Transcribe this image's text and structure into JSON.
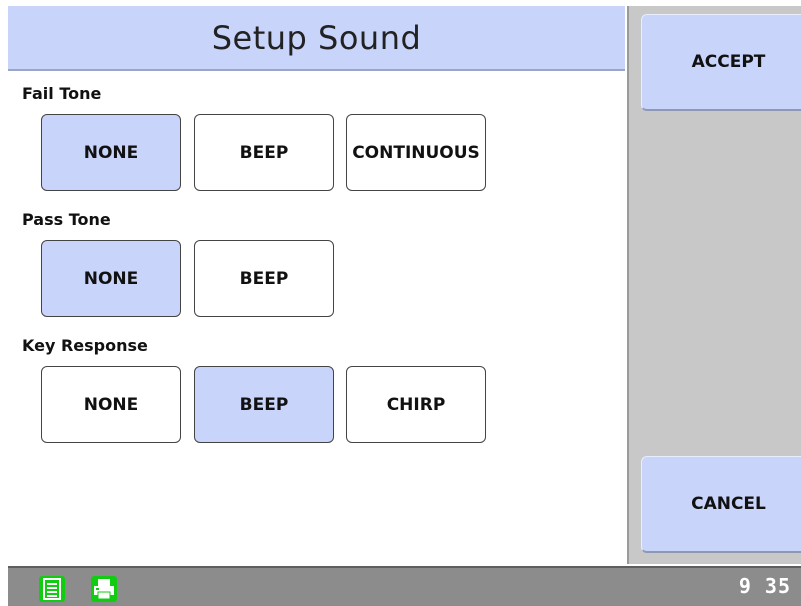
{
  "header": {
    "title": "Setup Sound"
  },
  "groups": [
    {
      "label": "Fail Tone",
      "options": [
        "NONE",
        "BEEP",
        "CONTINUOUS"
      ],
      "selected": "NONE"
    },
    {
      "label": "Pass Tone",
      "options": [
        "NONE",
        "BEEP"
      ],
      "selected": "NONE"
    },
    {
      "label": "Key Response",
      "options": [
        "NONE",
        "BEEP",
        "CHIRP"
      ],
      "selected": "BEEP"
    }
  ],
  "sidebar": {
    "accept_label": "ACCEPT",
    "cancel_label": "CANCEL"
  },
  "status": {
    "time_hours": "9",
    "time_minutes": "35",
    "icons": [
      "list-icon",
      "printer-icon"
    ]
  },
  "colors": {
    "selected": "#c9d4fb",
    "sidebar_bg": "#c8c8c8",
    "status_bg": "#8c8c8c",
    "status_icon": "#11cc11"
  }
}
